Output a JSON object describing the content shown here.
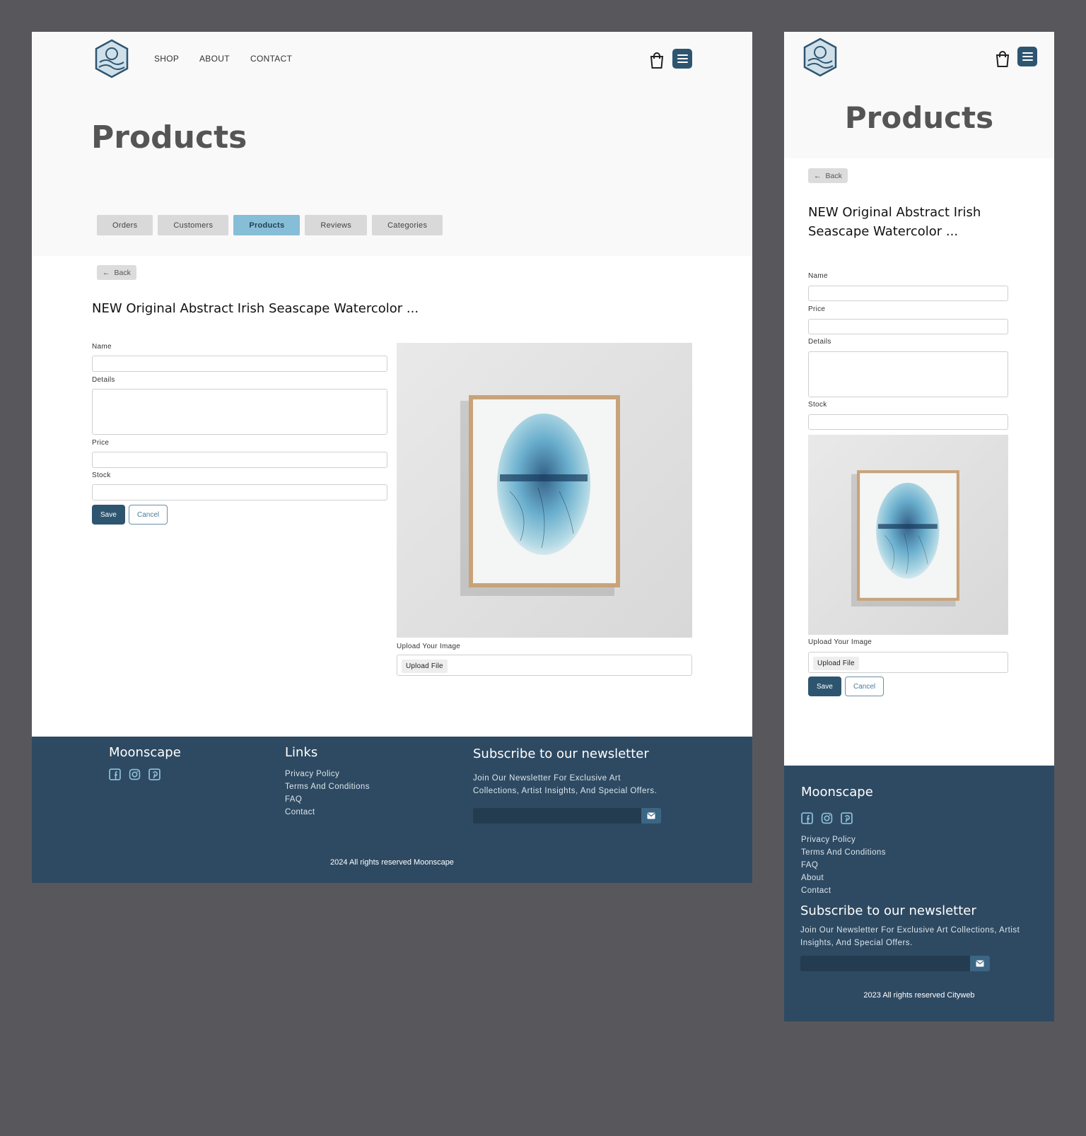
{
  "header": {
    "logo_alt": "Moonscape logo",
    "nav": [
      "SHOP",
      "ABOUT",
      "CONTACT"
    ]
  },
  "page": {
    "title": "Products",
    "tabs": [
      {
        "label": "Orders",
        "active": false
      },
      {
        "label": "Customers",
        "active": false
      },
      {
        "label": "Products",
        "active": true
      },
      {
        "label": "Reviews",
        "active": false
      },
      {
        "label": "Categories",
        "active": false
      }
    ],
    "back_label": "Back",
    "product_title": "NEW Original Abstract Irish Seascape Watercolor ...",
    "product_title_mobile": "NEW Original Abstract Irish Seascape Watercolor ..."
  },
  "form": {
    "name_label": "Name",
    "name_value": "",
    "details_label": "Details",
    "details_value": "",
    "price_label": "Price",
    "price_value": "",
    "stock_label": "Stock",
    "stock_value": "",
    "upload_label": "Upload Your Image",
    "upload_button": "Upload File",
    "save_label": "Save",
    "cancel_label": "Cancel"
  },
  "footer": {
    "brand": "Moonscape",
    "social_icons": [
      "facebook-icon",
      "instagram-icon",
      "pinterest-icon"
    ],
    "links_heading": "Links",
    "links": [
      "Privacy Policy",
      "Terms And Conditions",
      "FAQ",
      "Contact"
    ],
    "links_mobile": [
      "Privacy Policy",
      "Terms And Conditions",
      "FAQ",
      "About",
      "Contact"
    ],
    "newsletter_heading": "Subscribe to our newsletter",
    "newsletter_text": "Join Our Newsletter For Exclusive Art Collections, Artist Insights, And Special Offers.",
    "copyright": "2024 All rights reserved Moonscape",
    "copyright_mobile": "2023 All rights reserved Cityweb"
  },
  "colors": {
    "primary": "#2e5570",
    "footer_bg": "#2e4a62",
    "tab_active": "#86bdd7",
    "backdrop": "#58585c"
  }
}
